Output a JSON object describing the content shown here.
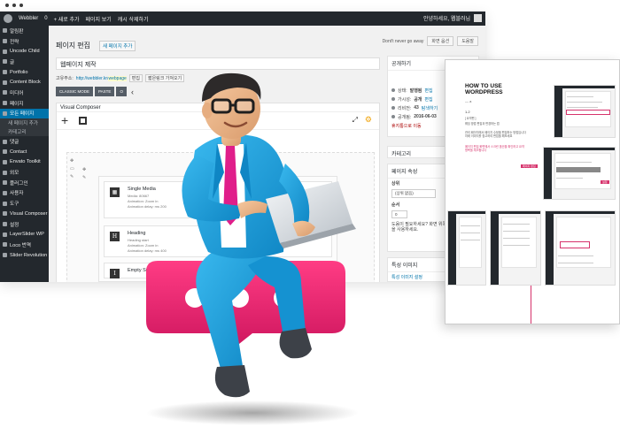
{
  "admin_bar": {
    "items": [
      "Webbler",
      "0",
      "+ 새로 추가",
      "페이지 보기",
      "캐시 삭제하기"
    ],
    "greeting": "안녕하세요, 웹블러님",
    "screen_options": "화면 옵션",
    "help": "도움말",
    "notice": "Dont't never go away"
  },
  "sidebar": {
    "items": [
      {
        "label": "알림판",
        "type": "item"
      },
      {
        "label": "전략",
        "type": "item"
      },
      {
        "label": "Uncode Child",
        "type": "item"
      },
      {
        "label": "글",
        "type": "item"
      },
      {
        "label": "Portfolio",
        "type": "item"
      },
      {
        "label": "Content Block",
        "type": "item"
      },
      {
        "label": "미디어",
        "type": "item"
      },
      {
        "label": "페이지",
        "type": "item"
      },
      {
        "label": "모든 페이지",
        "type": "active"
      },
      {
        "label": "새 페이지 추가",
        "type": "sub"
      },
      {
        "label": "카테고리",
        "type": "sub"
      },
      {
        "label": "댓글",
        "type": "item"
      },
      {
        "label": "Contact",
        "type": "item"
      },
      {
        "label": "Envato Toolkit",
        "type": "item"
      },
      {
        "label": "외모",
        "type": "item"
      },
      {
        "label": "플러그인",
        "type": "item"
      },
      {
        "label": "사용자",
        "type": "item"
      },
      {
        "label": "도구",
        "type": "item"
      },
      {
        "label": "Visual Composer",
        "type": "item"
      },
      {
        "label": "설정",
        "type": "item"
      },
      {
        "label": "LayerSlider WP",
        "type": "item"
      },
      {
        "label": "Loco 번역",
        "type": "item"
      },
      {
        "label": "Slider Revolution",
        "type": "item"
      }
    ]
  },
  "editor": {
    "page_heading": "페이지 편집",
    "add_new": "새 페이지 추가",
    "title_value": "웹페이지 제작",
    "permalink_label": "고유주소:",
    "permalink_url": "http://webbler.kr/",
    "permalink_slug": "webpage",
    "edit_btn": "편집",
    "shortlink_btn": "짧은링크 가져오기",
    "mode_classic": "CLASSIC MODE",
    "mode_paste": "PASTE",
    "mode_extra": "O",
    "vc_title": "Visual Composer",
    "elements": [
      {
        "name": "Single Media",
        "icon": "▦",
        "lines": [
          "Media: 80667",
          "Animation: Zoom in",
          "Animation delay: ms 200"
        ]
      },
      {
        "name": "Heading",
        "icon": "H",
        "lines": [
          "Heading start",
          "Animation: Zoom in",
          "Animation delay: ms 400"
        ]
      },
      {
        "name": "Empty Space",
        "icon": "I",
        "lines": []
      }
    ]
  },
  "publish": {
    "header": "공개하기",
    "preview": "변경 미리보기",
    "status_label": "상태:",
    "status_value": "발행됨",
    "status_link": "편집",
    "visibility_label": "가시성:",
    "visibility_value": "공개",
    "visibility_link": "편집",
    "revisions_label": "리비전:",
    "revisions_value": "43",
    "revisions_link": "탐색하기",
    "date_label": "공개됨:",
    "date_value": "2016-06-03",
    "trash": "휴지통으로 이동"
  },
  "category": {
    "header": "카테고리"
  },
  "attributes": {
    "header": "페이지 속성",
    "parent_label": "상위",
    "parent_value": "(상위 없음)",
    "order_label": "순서",
    "order_value": "0",
    "help": "도움이 필요하세요? 화면 위쪽에 있는 도움말을 사용하세요."
  },
  "featured": {
    "header": "특성 이미지",
    "link": "특성 이미지 설정"
  },
  "doc": {
    "title": "HOW TO USE WORDPRESS",
    "subtitle": "— a",
    "version": "1.2",
    "section": "[ 요약편 ]",
    "text1": "웨딩 방법 편집과 변경하는 법",
    "text2": "관리 페이지에서 페이지 수정을 편집하는 방법입니다 아래 이미지를 참고하여 편집을 해보세요",
    "text3": "페이지 편집 화면에서 스크린 옵션을 확인하고 요약 항목을 체크합니다",
    "tag1": "페이지 편집",
    "tag2": "설정"
  },
  "colors": {
    "admin_bar": "#23282d",
    "accent": "#0073aa",
    "pink": "#e31c6b",
    "suit": "#1a9fd8"
  }
}
